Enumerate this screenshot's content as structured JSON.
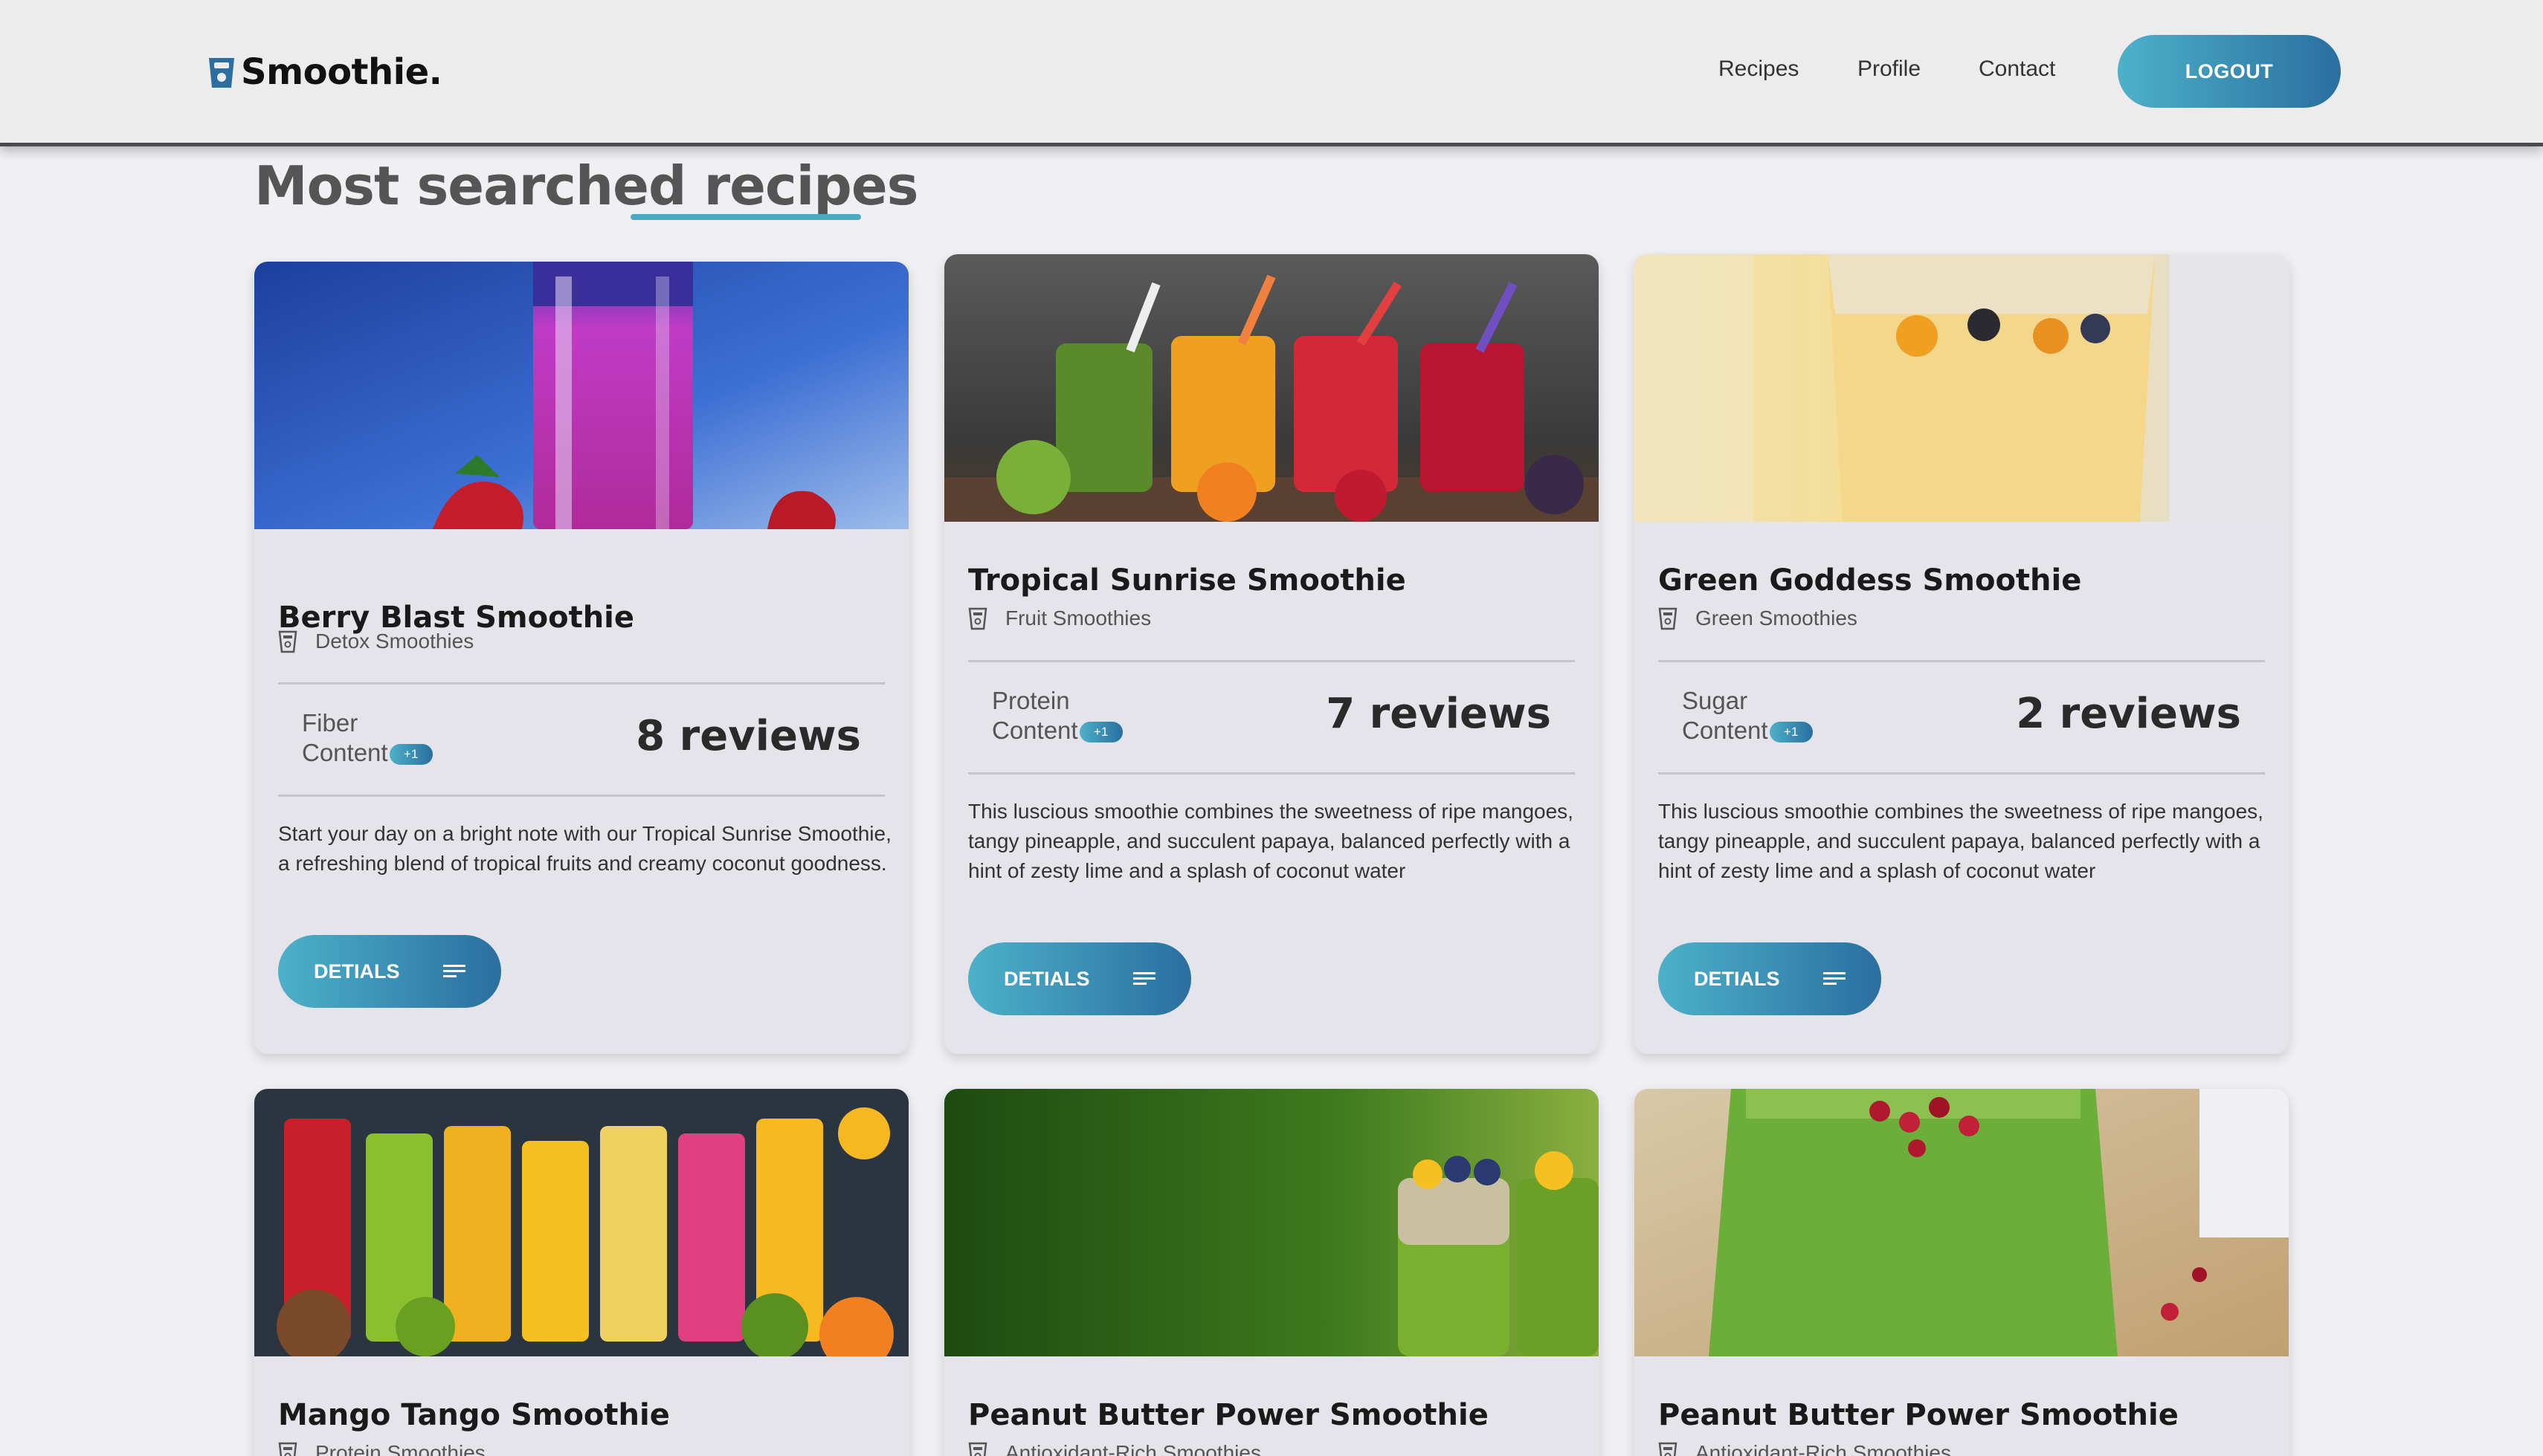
{
  "header": {
    "brand": "Smoothie.",
    "nav": [
      "Recipes",
      "Profile",
      "Contact"
    ],
    "logout_label": "LOGOUT"
  },
  "page_title": "Most searched recipes",
  "cards": [
    {
      "title": "Berry Blast Smoothie",
      "category": "Detox Smoothies",
      "nutrient_line1": "Fiber",
      "nutrient_line2": "Content",
      "badge": "+1",
      "reviews": "8 reviews",
      "description": "Start your day on a bright note with our Tropical Sunrise Smoothie, a refreshing blend of tropical fruits and creamy coconut goodness.",
      "button": "DETIALS",
      "image": "pink-berry-smoothie-photo"
    },
    {
      "title": "Tropical Sunrise Smoothie",
      "category": "Fruit Smoothies",
      "nutrient_line1": "Protein",
      "nutrient_line2": "Content",
      "badge": "+1",
      "reviews": "7 reviews",
      "description": "This luscious smoothie combines the sweetness of ripe mangoes, tangy pineapple, and succulent papaya, balanced perfectly with a hint of zesty lime and a splash of coconut water",
      "button": "DETIALS",
      "image": "four-juices-with-straws-photo"
    },
    {
      "title": "Green Goddess Smoothie",
      "category": "Green Smoothies",
      "nutrient_line1": "Sugar",
      "nutrient_line2": "Content",
      "badge": "+1",
      "reviews": "2 reviews",
      "description": "This luscious smoothie combines the sweetness of ripe mangoes, tangy pineapple, and succulent papaya, balanced perfectly with a hint of zesty lime and a splash of coconut water",
      "button": "DETIALS",
      "image": "yellow-mango-smoothie-photo"
    },
    {
      "title": "Mango Tango Smoothie",
      "category": "Protein Smoothies",
      "image": "colorful-juice-glasses-photo"
    },
    {
      "title": "Peanut Butter Power Smoothie",
      "category": "Antioxidant-Rich Smoothies",
      "image": "green-smoothie-jars-photo"
    },
    {
      "title": "Peanut Butter Power Smoothie",
      "category": "Antioxidant-Rich Smoothies",
      "image": "green-pomegranate-smoothie-photo"
    }
  ],
  "colors": {
    "accent_start": "#4db1c9",
    "accent_end": "#2a6fa0",
    "background": "#f0f0f4",
    "card": "#e4e4ea"
  }
}
